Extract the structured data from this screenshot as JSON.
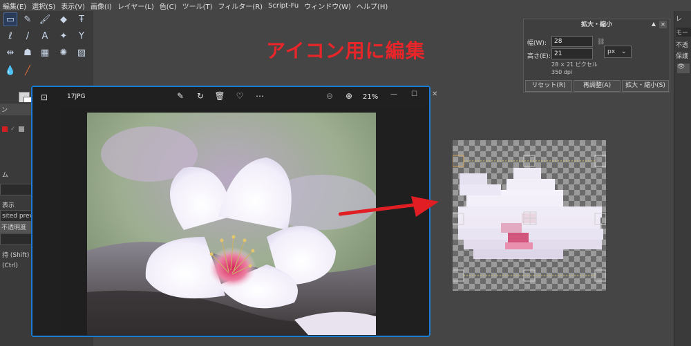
{
  "menu": [
    "編集(E)",
    "選択(S)",
    "表示(V)",
    "画像(I)",
    "レイヤー(L)",
    "色(C)",
    "ツール(T)",
    "フィルター(R)",
    "Script-Fu",
    "ウィンドウ(W)",
    "ヘルプ(H)"
  ],
  "overlay_title": "アイコン用に編集",
  "left_panel": {
    "tab_label": "ン",
    "mode_label": "ム",
    "display_label": "表示",
    "composited_preview": "sited previ",
    "opacity_label": "不透明度",
    "keep_shift": "持 (Shift)",
    "ctrl": "(Ctrl)"
  },
  "scale_dialog": {
    "title": "拡大・縮小",
    "width_label": "幅(W):",
    "width_value": "28",
    "height_label": "高さ(E):",
    "height_value": "21",
    "unit": "px",
    "size_info": "28 × 21 ピクセル",
    "dpi_info": "350 dpi",
    "reset_button": "リセット(R)",
    "readjust_button": "再調整(A)",
    "scale_button": "拡大・縮小(S)"
  },
  "right_dock": {
    "tab": "レ",
    "mode": "モー",
    "opacity": "不透",
    "protect": "保護"
  },
  "photos_app": {
    "file_name": "17JPG",
    "zoom": "21%"
  },
  "colors": {
    "accent_title": "#e8262a",
    "window_border": "#1a7fd4",
    "arrow": "#e01e24"
  }
}
